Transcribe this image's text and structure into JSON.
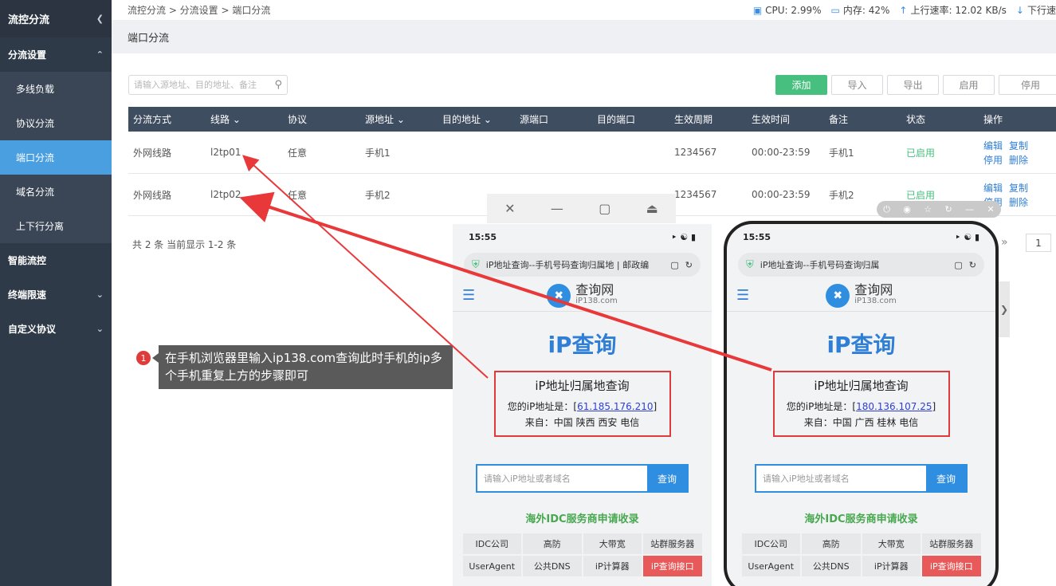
{
  "sidebar": {
    "header": "流控分流",
    "items": [
      {
        "label": "分流设置",
        "expanded": true
      },
      {
        "label": "多线负载"
      },
      {
        "label": "协议分流"
      },
      {
        "label": "端口分流"
      },
      {
        "label": "域名分流"
      },
      {
        "label": "上下行分离"
      },
      {
        "label": "智能流控"
      },
      {
        "label": "终端限速"
      },
      {
        "label": "自定义协议"
      }
    ]
  },
  "topbar": {
    "breadcrumb": "流控分流 > 分流设置 > 端口分流",
    "cpu": "CPU: 2.99%",
    "mem": "内存: 42%",
    "up": "上行速率: 12.02 KB/s",
    "down": "下行速"
  },
  "page": {
    "title": "端口分流",
    "search_placeholder": "请输入源地址、目的地址、备注",
    "buttons": {
      "add": "添加",
      "import": "导入",
      "export": "导出",
      "enable": "启用",
      "disable": "停用"
    }
  },
  "table": {
    "headers": [
      "分流方式",
      "线路",
      "协议",
      "源地址",
      "目的地址",
      "源端口",
      "目的端口",
      "生效周期",
      "生效时间",
      "备注",
      "状态",
      "操作"
    ],
    "rows": [
      {
        "mode": "外网线路",
        "line": "l2tp01",
        "proto": "任意",
        "src": "手机1",
        "dst": "",
        "sport": "",
        "dport": "",
        "period": "1234567",
        "time": "00:00-23:59",
        "note": "手机1",
        "status": "已启用"
      },
      {
        "mode": "外网线路",
        "line": "l2tp02",
        "proto": "任意",
        "src": "手机2",
        "dst": "",
        "sport": "",
        "dport": "",
        "period": "1234567",
        "time": "00:00-23:59",
        "note": "手机2",
        "status": "已启用"
      }
    ],
    "ops": {
      "edit": "编辑",
      "copy": "复制",
      "disable": "停用",
      "delete": "删除"
    },
    "total": "共 2 条 当前显示 1-2 条",
    "page": "1"
  },
  "annotation": {
    "num": "1",
    "text": "在手机浏览器里输入ip138.com查询此时手机的ip多个手机重复上方的步骤即可"
  },
  "phone_left": {
    "time": "15:55",
    "url": "iP地址查询--手机号码查询归属地 | 邮政编",
    "logo": "查询网",
    "logo_sub": "iP138.com",
    "heading": "iP查询",
    "box_title": "iP地址归属地查询",
    "ip_label": "您的iP地址是：[",
    "ip": "61.185.176.210",
    "ip_end": "]",
    "from": "来自：中国 陕西 西安 电信",
    "query_placeholder": "请输入iP地址或者域名",
    "query_btn": "查询",
    "idc": "海外IDC服务商申请收录",
    "grid": [
      "IDC公司",
      "高防",
      "大带宽",
      "站群服务器",
      "UserAgent",
      "公共DNS",
      "iP计算器",
      "iP查询接口"
    ]
  },
  "phone_right": {
    "time": "15:55",
    "url": "iP地址查询--手机号码查询归属",
    "logo": "查询网",
    "logo_sub": "iP138.com",
    "heading": "iP查询",
    "box_title": "iP地址归属地查询",
    "ip_label": "您的iP地址是：[",
    "ip": "180.136.107.25",
    "ip_end": "]",
    "from": "来自：中国 广西 桂林 电信",
    "query_placeholder": "请输入iP地址或者域名",
    "query_btn": "查询",
    "idc": "海外IDC服务商申请收录",
    "grid": [
      "IDC公司",
      "高防",
      "大带宽",
      "站群服务器",
      "UserAgent",
      "公共DNS",
      "iP计算器",
      "iP查询接口"
    ]
  }
}
